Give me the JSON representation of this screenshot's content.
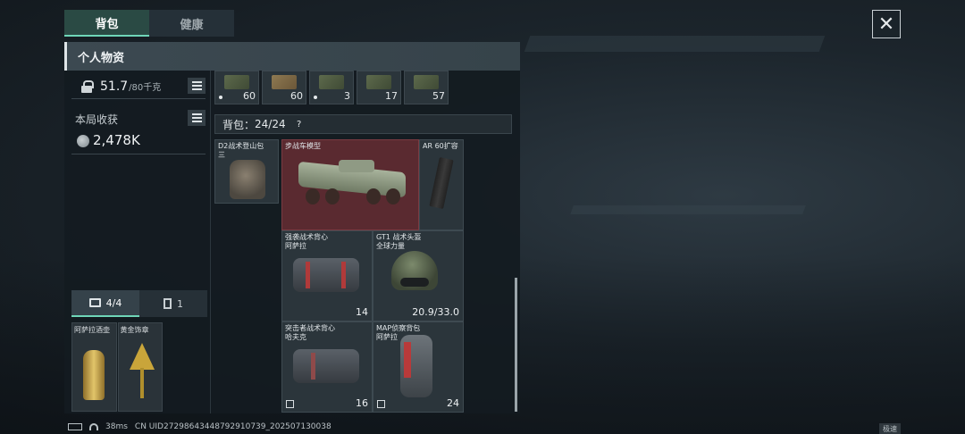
{
  "tabs": [
    {
      "label": "背包",
      "active": true
    },
    {
      "label": "健康",
      "active": false
    }
  ],
  "panel": {
    "title": "个人物资"
  },
  "weight": {
    "current": "51.7",
    "max": "/80千克"
  },
  "harvest": {
    "label": "本局收获",
    "value": "2,478K"
  },
  "ammo": [
    {
      "count": "60",
      "dot": true,
      "color": "green"
    },
    {
      "count": "60",
      "dot": false,
      "color": "tan"
    },
    {
      "count": "3",
      "dot": true,
      "color": "green"
    },
    {
      "count": "17",
      "dot": false,
      "color": "green"
    },
    {
      "count": "57",
      "dot": false,
      "color": "green"
    }
  ],
  "bag": {
    "label": "背包：",
    "capacity": "24/24",
    "help": "?"
  },
  "items": [
    {
      "label": "D2战术登山包\n三",
      "count": ""
    },
    {
      "label": "步战车模型",
      "count": ""
    },
    {
      "label": "AR 60扩容",
      "count": ""
    },
    {
      "label": "强袭战术背心\n阿萨拉",
      "count": "14"
    },
    {
      "label": "GT1 战术头盔\n全球力量",
      "count": "20.9/33.0"
    },
    {
      "label": "突击者战术背心\n哈夫克",
      "count": "16"
    },
    {
      "label": "MAP侦察背包\n阿萨拉",
      "count": "24"
    }
  ],
  "equip_tabs": [
    {
      "label": "4/4",
      "icon": "toolbox-icon",
      "active": true
    },
    {
      "label": "1",
      "icon": "card-icon",
      "active": false
    }
  ],
  "equip_items": [
    {
      "label": "阿萨拉酒壶"
    },
    {
      "label": "黄金饰章"
    }
  ],
  "status": {
    "ping": "38ms",
    "uid": "CN UID27298643448792910739_202507130038",
    "corner": "极速"
  },
  "colors": {
    "accent": "#6fd6b8",
    "highlight_red": "#5a2a30"
  }
}
